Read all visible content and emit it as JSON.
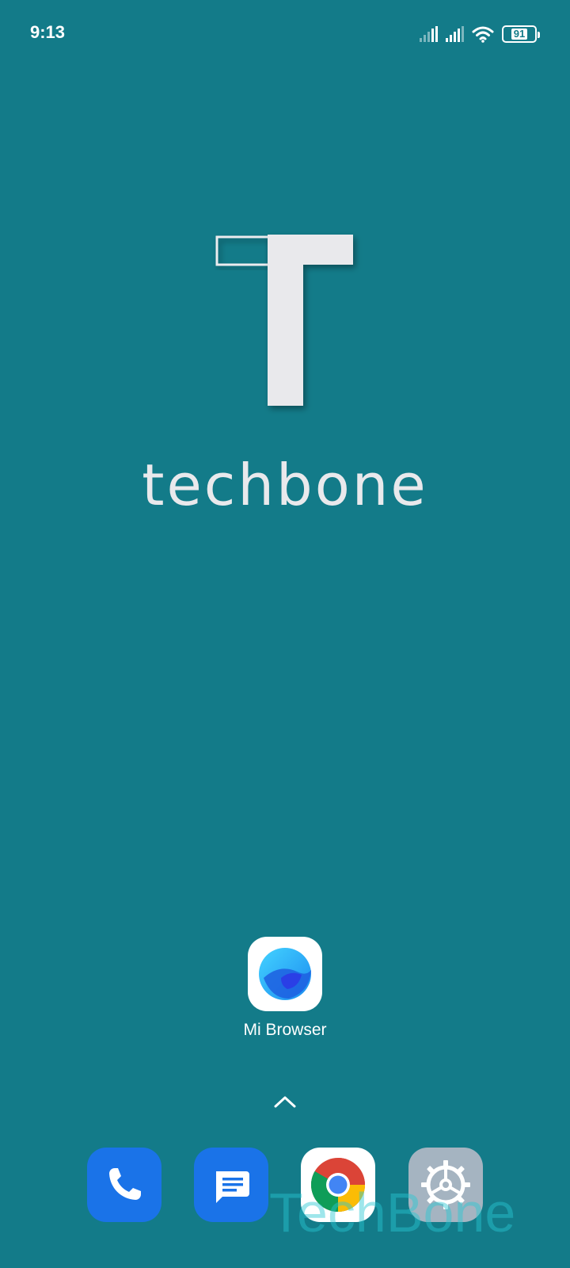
{
  "status_bar": {
    "time": "9:13",
    "battery_level": "91",
    "icons": [
      "signal-icon",
      "signal-icon",
      "wifi-icon",
      "battery-icon"
    ]
  },
  "wallpaper": {
    "wordmark": "techbone",
    "logo_icon": "techbone-t-logo-icon",
    "background_color": "#137b89"
  },
  "home_apps": [
    {
      "label": "Mi Browser",
      "icon": "mi-browser-icon"
    }
  ],
  "app_drawer": {
    "icon": "chevron-up-icon"
  },
  "dock": [
    {
      "app": "phone",
      "icon": "phone-icon"
    },
    {
      "app": "messages",
      "icon": "messages-icon"
    },
    {
      "app": "chrome",
      "icon": "chrome-icon"
    },
    {
      "app": "settings",
      "icon": "settings-gear-icon"
    }
  ],
  "watermark": {
    "text": "TechBone"
  }
}
